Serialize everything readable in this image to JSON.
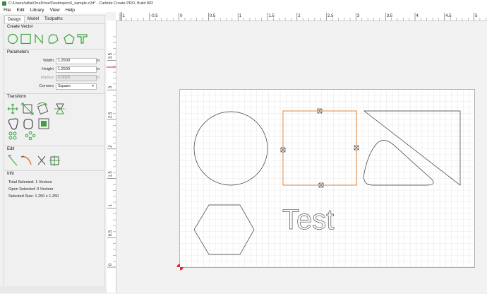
{
  "titlebar": {
    "title": "C:/Users/willa/OneDrive/Desktop/cc6_sample.c2d* - Carbide Create PRO, Build 802"
  },
  "menu": {
    "file": "File",
    "edit": "Edit",
    "library": "Library",
    "view": "View",
    "help": "Help"
  },
  "tabs": {
    "design": "Design",
    "model": "Model",
    "toolpaths": "Toolpaths"
  },
  "sections": {
    "create_vector": "Create Vector",
    "parameters": "Parameters",
    "transform": "Transform",
    "edit": "Edit",
    "info": "Info"
  },
  "params": {
    "width_label": "Width",
    "width_value": "1.2500",
    "width_unit": "in",
    "height_label": "Height",
    "height_value": "1.2500",
    "height_unit": "in",
    "radius_label": "Radius",
    "radius_value": "0.0020",
    "radius_unit": "in",
    "corners_label": "Corners",
    "corners_value": "Square"
  },
  "info": {
    "total_selected": "Total Selected:   1 Vectors",
    "open_selected": "Open Selected:   0 Vectors",
    "selected_size": "Selected Size:    1.250 x 1.250"
  },
  "canvas": {
    "text_object": "Test"
  },
  "rulers": {
    "x_ticks": [
      "-1",
      "-0.5",
      "0",
      "0.5",
      "1",
      "1.5",
      "2",
      "2.5",
      "3",
      "3.5",
      "4",
      "4.5",
      "5"
    ],
    "y_ticks": [
      "3.5",
      "3",
      "2.5",
      "2",
      "1.5",
      "1",
      "0.5",
      "0"
    ]
  },
  "colors": {
    "accent": "#3aa43a",
    "selection": "#e07a2a",
    "grid": "#d4d4d4"
  }
}
